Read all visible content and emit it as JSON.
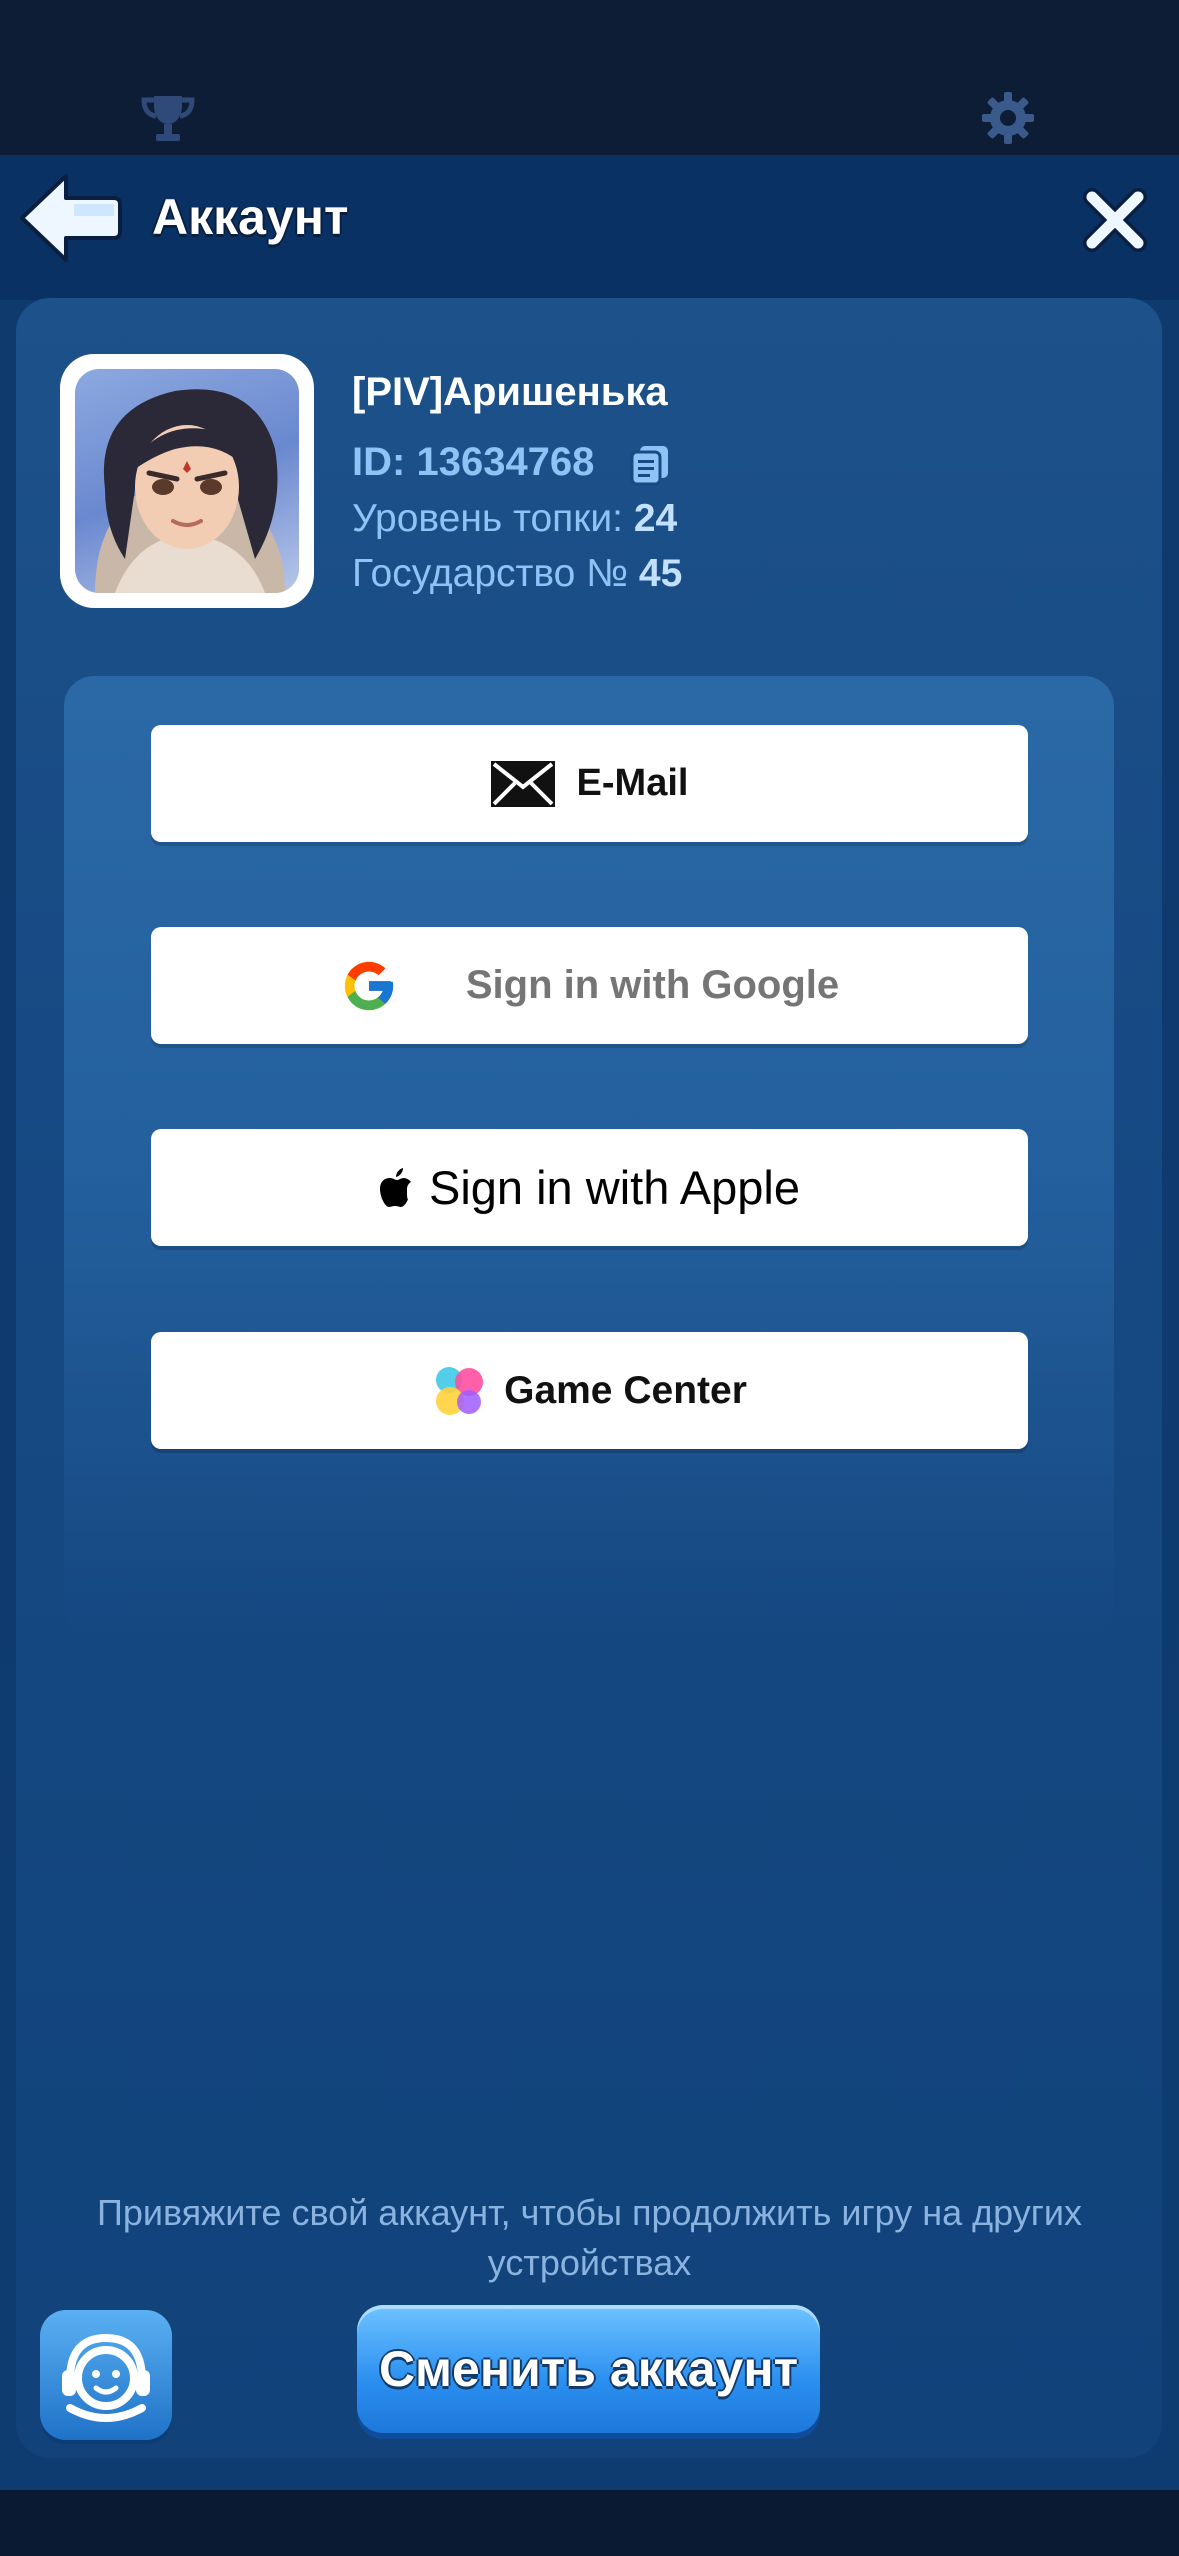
{
  "header": {
    "title": "Аккаунт",
    "back_icon": "arrow-left-icon",
    "close_icon": "close-icon"
  },
  "top_icons": [
    "trophy-icon",
    "gear-icon"
  ],
  "profile": {
    "name": "[PIV]Аришенька",
    "id_label": "ID:",
    "id_value": "13634768",
    "level_label": "Уровень топки:",
    "level_value": "24",
    "state_label": "Государство №",
    "state_value": "45"
  },
  "login_buttons": {
    "email": "E-Mail",
    "google": "Sign in with Google",
    "apple": "Sign in with Apple",
    "game_center": "Game Center"
  },
  "footer": {
    "note": "Привяжите свой аккаунт, чтобы продолжить игру на других устройствах",
    "switch_button": "Сменить аккаунт",
    "support_icon": "support-agent-icon"
  },
  "colors": {
    "panel": "#174a84",
    "accent_text": "#8fc3f5",
    "switch_button": "#2a8ff0"
  }
}
